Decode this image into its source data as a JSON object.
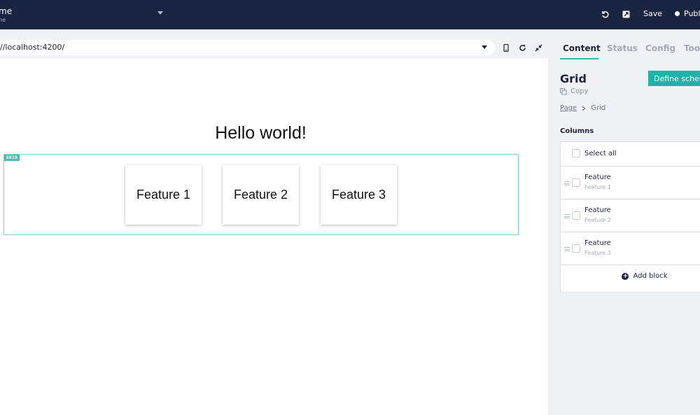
{
  "header": {
    "title": "me",
    "subtitle": "ne",
    "save_label": "Save",
    "publish_label": "Publ",
    "icons": [
      "undo-icon",
      "external-edit-icon",
      "chevron-down-icon"
    ]
  },
  "preview": {
    "url": "//localhost:4200/",
    "icons": [
      "mobile-view-icon",
      "reload-icon",
      "collapse-icon"
    ],
    "heading": "Hello world!",
    "grid_tag": "GRID",
    "features": [
      "Feature 1",
      "Feature 2",
      "Feature 3"
    ]
  },
  "panel": {
    "tabs": [
      {
        "label": "Content",
        "active": true
      },
      {
        "label": "Status",
        "active": false
      },
      {
        "label": "Config",
        "active": false
      },
      {
        "label": "Tool",
        "active": false
      }
    ],
    "title": "Grid",
    "define_schema_label": "Define schem",
    "copy_label": "Copy",
    "breadcrumb": {
      "parent": "Page",
      "current": "Grid"
    },
    "columns_label": "Columns",
    "select_all_label": "Select all",
    "rows": [
      {
        "label": "Feature",
        "sub": "Feature 1"
      },
      {
        "label": "Feature",
        "sub": "Feature 2"
      },
      {
        "label": "Feature",
        "sub": "Feature 3"
      }
    ],
    "add_block_label": "Add block"
  },
  "colors": {
    "topbar": "#1b2542",
    "accent": "#1db3a9",
    "grid_outline": "#7fcfc6"
  }
}
